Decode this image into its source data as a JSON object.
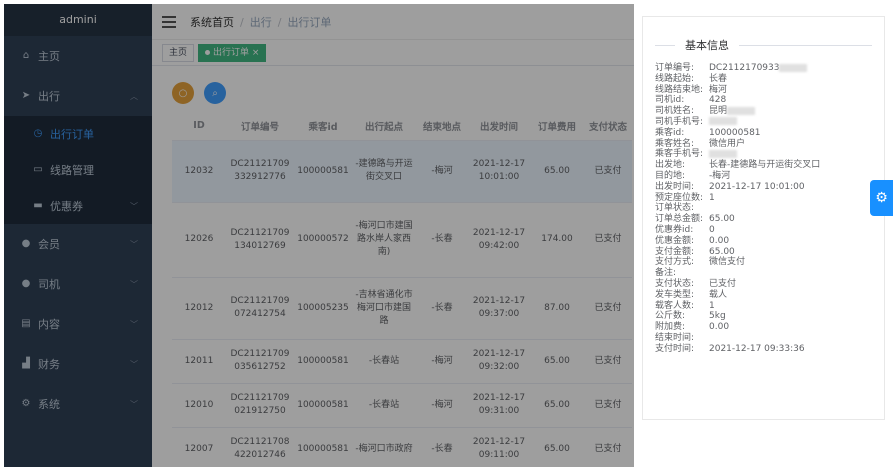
{
  "app": {
    "brand": "admini"
  },
  "sidebar": {
    "items": [
      {
        "label": "主页",
        "icon": "home-icon"
      },
      {
        "label": "出行",
        "icon": "send-icon"
      },
      {
        "label": "出行订单",
        "icon": "clock-icon"
      },
      {
        "label": "线路管理",
        "icon": "route-icon"
      },
      {
        "label": "优惠券",
        "icon": "coupon-icon"
      },
      {
        "label": "会员",
        "icon": "user-icon"
      },
      {
        "label": "司机",
        "icon": "driver-icon"
      },
      {
        "label": "内容",
        "icon": "content-icon"
      },
      {
        "label": "财务",
        "icon": "finance-icon"
      },
      {
        "label": "系统",
        "icon": "gear-icon"
      }
    ]
  },
  "breadcrumb": {
    "home": "系统首页",
    "level1": "出行",
    "level2": "出行订单"
  },
  "tags": {
    "home": "主页",
    "active": "出行订单"
  },
  "table": {
    "columns": [
      "ID",
      "订单编号",
      "乘客id",
      "出行起点",
      "结束地点",
      "出发时间",
      "订单费用",
      "支付状态"
    ],
    "rows": [
      {
        "id": "12032",
        "order": "DC21121709332912776",
        "passenger": "100000581",
        "start": "-建德路与开运街交叉口",
        "end": "-梅河",
        "time": "2021-12-17 10:01:00",
        "fee": "65.00",
        "status": "已支付"
      },
      {
        "id": "12026",
        "order": "DC21121709134012769",
        "passenger": "100000572",
        "start": "-梅河口市建国路水岸人家西南)",
        "end": "-长春",
        "time": "2021-12-17 09:42:00",
        "fee": "174.00",
        "status": "已支付"
      },
      {
        "id": "12012",
        "order": "DC21121709072412754",
        "passenger": "100005235",
        "start": "-吉林省通化市梅河口市建国路",
        "end": "-长春",
        "time": "2021-12-17 09:37:00",
        "fee": "87.00",
        "status": "已支付"
      },
      {
        "id": "12011",
        "order": "DC21121709035612752",
        "passenger": "100000581",
        "start": "-长春站",
        "end": "-梅河",
        "time": "2021-12-17 09:32:00",
        "fee": "65.00",
        "status": "已支付"
      },
      {
        "id": "12010",
        "order": "DC21121709021912750",
        "passenger": "100000581",
        "start": "-长春站",
        "end": "-梅河",
        "time": "2021-12-17 09:31:00",
        "fee": "65.00",
        "status": "已支付"
      },
      {
        "id": "12007",
        "order": "DC21121708422012746",
        "passenger": "100000581",
        "start": "-梅河口市政府",
        "end": "-长春",
        "time": "2021-12-17 09:11:00",
        "fee": "65.00",
        "status": "已支付"
      }
    ]
  },
  "drawer": {
    "title": "基本信息",
    "fields": [
      {
        "k": "订单编号:",
        "v": "DC2112170933",
        "blur": true
      },
      {
        "k": "线路起始:",
        "v": "长春"
      },
      {
        "k": "线路结束地:",
        "v": "梅河"
      },
      {
        "k": "司机id:",
        "v": "428"
      },
      {
        "k": "司机姓名:",
        "v": "昆明",
        "blur": true
      },
      {
        "k": "司机手机号:",
        "v": "",
        "blur": true
      },
      {
        "k": "乘客id:",
        "v": "100000581"
      },
      {
        "k": "乘客姓名:",
        "v": "微信用户"
      },
      {
        "k": "乘客手机号:",
        "v": "",
        "blur": true
      },
      {
        "k": "出发地:",
        "v": "长春-建德路与开运街交叉口"
      },
      {
        "k": "目的地:",
        "v": "-梅河"
      },
      {
        "k": "出发时间:",
        "v": "2021-12-17 10:01:00"
      },
      {
        "k": "预定座位数:",
        "v": "1"
      },
      {
        "k": "订单状态:",
        "v": ""
      },
      {
        "k": "订单总金额:",
        "v": "65.00"
      },
      {
        "k": "优惠券id:",
        "v": "0"
      },
      {
        "k": "优惠金额:",
        "v": "0.00"
      },
      {
        "k": "支付金额:",
        "v": "65.00"
      },
      {
        "k": "支付方式:",
        "v": "微信支付"
      },
      {
        "k": "备注:",
        "v": ""
      },
      {
        "k": "支付状态:",
        "v": "已支付"
      },
      {
        "k": "发车类型:",
        "v": "载人"
      },
      {
        "k": "载客人数:",
        "v": "1"
      },
      {
        "k": "公斤数:",
        "v": "5kg"
      },
      {
        "k": "附加费:",
        "v": "0.00"
      },
      {
        "k": "结束时间:",
        "v": ""
      },
      {
        "k": "支付时间:",
        "v": "2021-12-17 09:33:36"
      }
    ]
  },
  "colors": {
    "sidebar": "#304156",
    "accent": "#409eff",
    "tag_active": "#42b983"
  }
}
